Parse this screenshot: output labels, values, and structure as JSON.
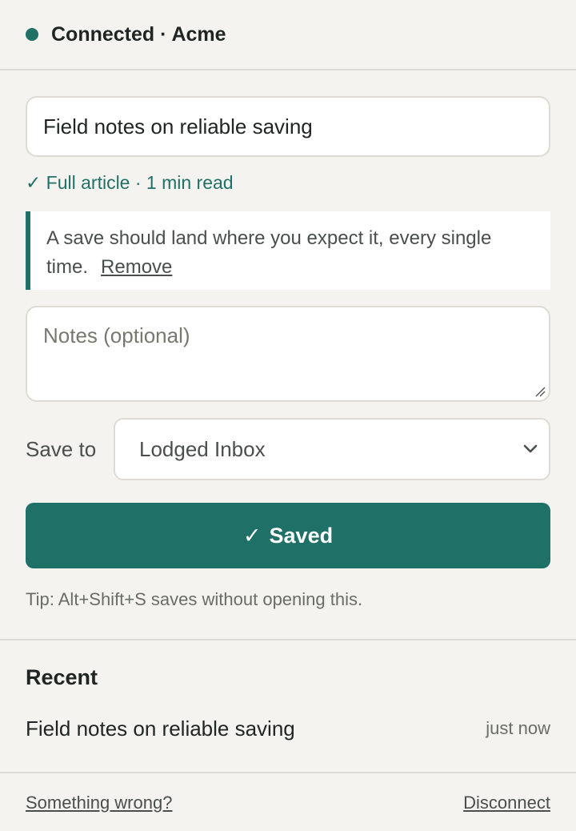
{
  "header": {
    "status_text": "Connected · Acme",
    "status_color": "#1f7168"
  },
  "form": {
    "title_value": "Field notes on reliable saving",
    "meta_text": "✓ Full article · 1 min read",
    "excerpt_text": "A save should land where you expect it, every single time.",
    "remove_label": "Remove",
    "notes_placeholder": "Notes (optional)",
    "notes_value": "",
    "save_to_label": "Save to",
    "save_to_selected": "Lodged Inbox",
    "saved_button_check": "✓",
    "saved_button_label": "Saved",
    "tip_text": "Tip: Alt+Shift+S saves without opening this."
  },
  "recent": {
    "heading": "Recent",
    "items": [
      {
        "title": "Field notes on reliable saving",
        "time": "just now"
      }
    ]
  },
  "footer": {
    "something_wrong_label": "Something wrong?",
    "disconnect_label": "Disconnect"
  },
  "colors": {
    "accent": "#1f7168",
    "background": "#f5f3ef"
  }
}
